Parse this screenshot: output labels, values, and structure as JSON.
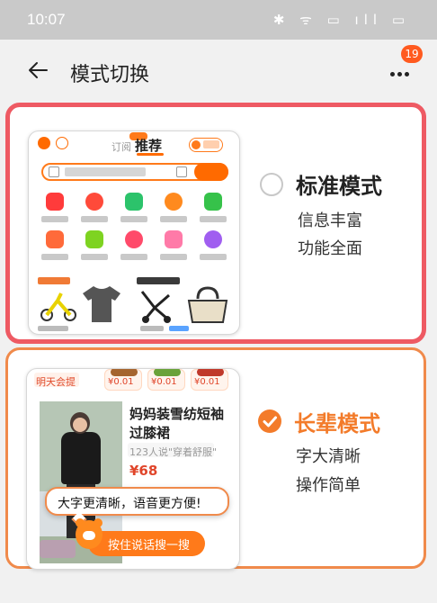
{
  "status_bar": {
    "time": "10:07",
    "icons_text": "✱ ᯤ ▭ ıll ▭"
  },
  "header": {
    "title": "模式切换",
    "notification_badge": "19"
  },
  "modes": [
    {
      "name": "标准模式",
      "desc_line1": "信息丰富",
      "desc_line2": "功能全面",
      "selected": false
    },
    {
      "name": "长辈模式",
      "desc_line1": "字大清晰",
      "desc_line2": "操作简单",
      "selected": true
    }
  ],
  "preview_standard": {
    "tab_follow": "订阅",
    "tab_recommend": "推荐"
  },
  "preview_elder": {
    "banner": "明天会提",
    "chip_price": "¥0.01",
    "product_title_line1": "妈妈装雪纺短袖",
    "product_title_line2": "过膝裙",
    "product_sub": "123人说\"穿着舒服\"",
    "price": "¥68",
    "tooltip": "大字更清晰，语音更方便!",
    "voice_button": "按住说话搜一搜"
  },
  "colors": {
    "accent": "#ff6a00",
    "selected_border": "#ee5a63",
    "elder_border": "#f08a4b",
    "check": "#f37b2a"
  }
}
